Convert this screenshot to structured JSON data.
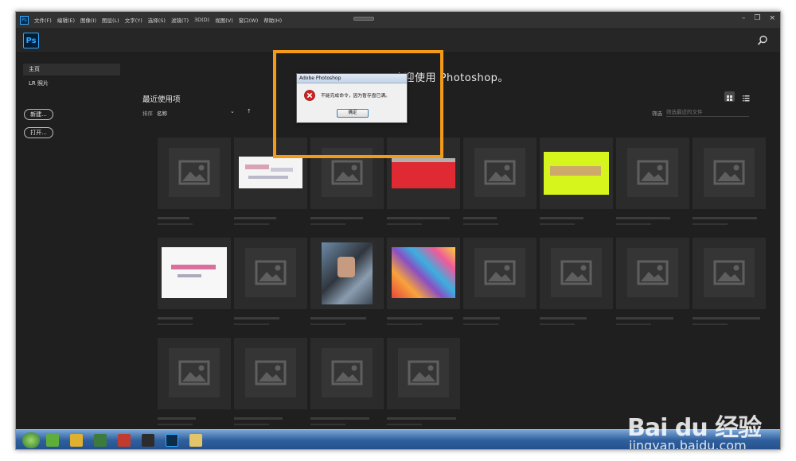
{
  "menubar": {
    "app_icon": "Ps",
    "items": [
      "文件(F)",
      "编辑(E)",
      "图像(I)",
      "图层(L)",
      "文字(Y)",
      "选择(S)",
      "滤镜(T)",
      "3D(D)",
      "视图(V)",
      "窗口(W)",
      "帮助(H)"
    ],
    "window_controls": [
      "–",
      "❐",
      "×"
    ]
  },
  "topbar": {
    "logo": "Ps",
    "search_icon": "search-icon"
  },
  "sidebar": {
    "items": [
      "主页",
      "LR 照片"
    ],
    "buttons": [
      "新建...",
      "打开..."
    ]
  },
  "main": {
    "welcome": "欢迎使用 Photoshop。",
    "recent_title": "最近使用项",
    "sort_label": "排序",
    "sort_value": "名称",
    "sort_chevron": "⌄",
    "sort_direction": "↑",
    "filter_label": "筛选",
    "filter_placeholder": "筛选最近的文件"
  },
  "dialog": {
    "title": "Adobe Photoshop",
    "message": "不能完成命令，因为暂存盘已满。",
    "ok_label": "确定",
    "icon": "error-icon"
  },
  "watermark": {
    "logo": "Bai du 经验",
    "url": "jingyan.baidu.com"
  },
  "colors": {
    "accent": "#31a8ff",
    "highlight": "#f39a18",
    "background": "#1f1f1f",
    "tile": "#2b2b2b"
  }
}
